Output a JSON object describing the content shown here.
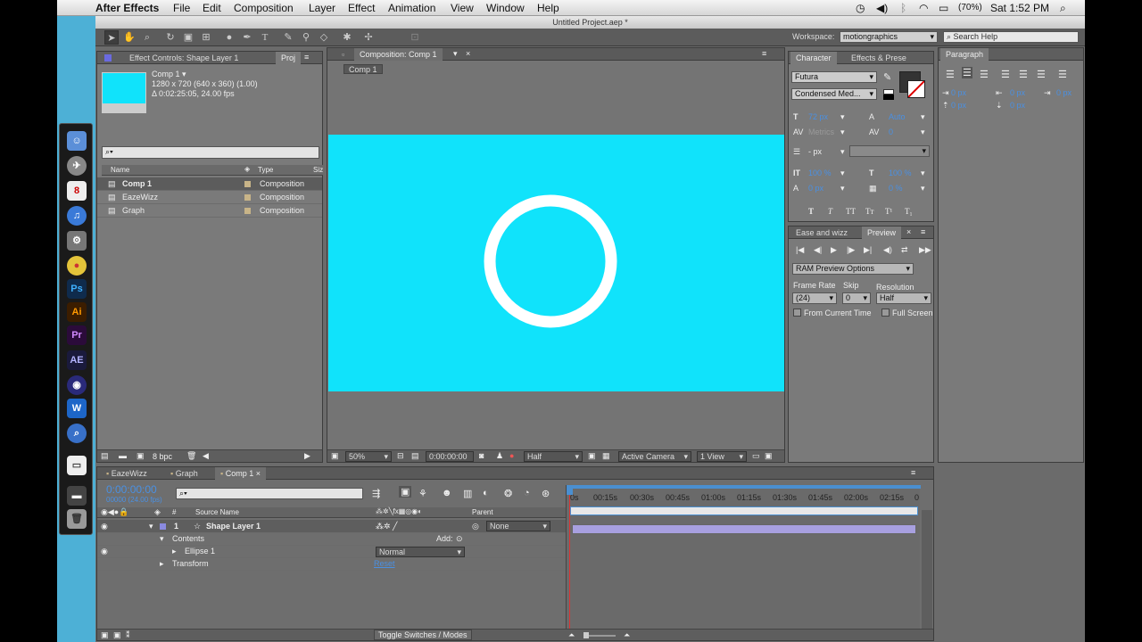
{
  "menubar": {
    "app": "After Effects",
    "items": [
      "File",
      "Edit",
      "Composition",
      "Layer",
      "Effect",
      "Animation",
      "View",
      "Window",
      "Help"
    ],
    "battery": "(70%)",
    "clock": "Sat 1:52 PM"
  },
  "window": {
    "title": "Untitled Project.aep *"
  },
  "workspace": {
    "label": "Workspace:",
    "value": "motiongraphics",
    "search_placeholder": "Search Help"
  },
  "project_panel": {
    "tabs": [
      "Effect Controls: Shape Layer 1",
      "Proj"
    ],
    "comp_name": "Comp 1 ▾",
    "comp_size": "1280 x 720  (640 x 360) (1.00)",
    "comp_duration": "Δ 0:02:25:05, 24.00 fps",
    "search_placeholder": "⌕▾",
    "columns": [
      "Name",
      "Type",
      "Siz"
    ],
    "items": [
      {
        "name": "Comp 1",
        "type": "Composition"
      },
      {
        "name": "EazeWizz",
        "type": "Composition"
      },
      {
        "name": "Graph",
        "type": "Composition"
      }
    ],
    "bpc": "8 bpc"
  },
  "comp_panel": {
    "tab": "Composition: Comp 1",
    "breadcrumb": "Comp 1",
    "zoom": "50%",
    "timecode": "0:00:00:00",
    "resolution": "Half",
    "camera": "Active Camera",
    "view": "1 View",
    "bg_color": "#10e3fb"
  },
  "character": {
    "tabs": [
      "Character",
      "Effects & Prese"
    ],
    "font": "Futura",
    "style": "Condensed Med...",
    "size": "72 px",
    "leading": "Auto",
    "kerning": "Metrics",
    "tracking": "0",
    "stroke": "- px",
    "vscale": "100 %",
    "hscale": "100 %",
    "baseline": "0 px",
    "tsume": "0 %"
  },
  "paragraph": {
    "tab": "Paragraph",
    "v1": "0 px",
    "v2": "0 px",
    "v3": "0 px",
    "v4": "0 px",
    "v5": "0 px"
  },
  "preview": {
    "tabs": [
      "Ease and wizz",
      "Preview"
    ],
    "ram": "RAM Preview Options",
    "frame_rate_label": "Frame Rate",
    "skip_label": "Skip",
    "resolution_label": "Resolution",
    "frame_rate": "(24)",
    "skip": "0",
    "resolution": "Half",
    "from_current": "From Current Time",
    "full_screen": "Full Screen"
  },
  "timeline": {
    "tabs": [
      "EazeWizz",
      "Graph",
      "Comp 1"
    ],
    "timecode": "0:00:00:00",
    "fps": "00000 (24.00 fps)",
    "col_source": "Source Name",
    "col_parent": "Parent",
    "layer_num": "1",
    "layer_name": "Shape Layer 1",
    "parent_value": "None",
    "contents": "Contents",
    "add": "Add:",
    "ellipse": "Ellipse 1",
    "blend": "Normal",
    "transform": "Transform",
    "reset": "Reset",
    "ruler": [
      "0s",
      "00:15s",
      "00:30s",
      "00:45s",
      "01:00s",
      "01:15s",
      "01:30s",
      "01:45s",
      "02:00s",
      "02:15s",
      "0"
    ],
    "toggle": "Toggle Switches / Modes"
  }
}
